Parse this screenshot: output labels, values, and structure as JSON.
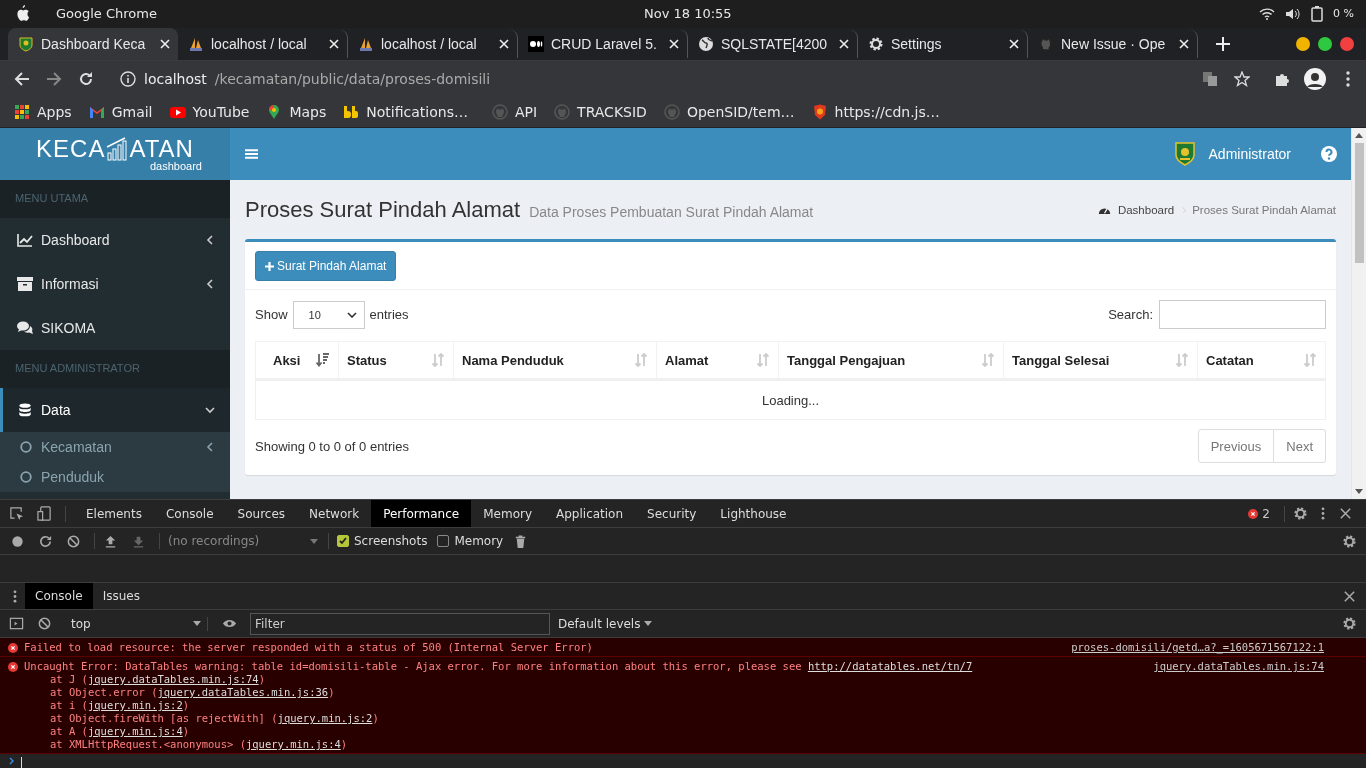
{
  "os_bar": {
    "app_name": "Google Chrome",
    "datetime": "Nov 18  10:55",
    "battery": "0 %"
  },
  "tabs": [
    {
      "title": "Dashboard Keca",
      "kind": "crest",
      "selected": true
    },
    {
      "title": "localhost / local",
      "kind": "sail",
      "selected": false
    },
    {
      "title": "localhost / local",
      "kind": "sail",
      "selected": false
    },
    {
      "title": "CRUD Laravel 5.",
      "kind": "dots",
      "selected": false
    },
    {
      "title": "SQLSTATE[4200",
      "kind": "globe",
      "selected": false
    },
    {
      "title": "Settings",
      "kind": "gear",
      "selected": false
    },
    {
      "title": "New Issue · Ope",
      "kind": "cat",
      "selected": false
    }
  ],
  "address": {
    "host": "localhost",
    "path": "/kecamatan/public/data/proses-domisili"
  },
  "bookmarks": [
    {
      "label": "Apps",
      "kind": "grid"
    },
    {
      "label": "Gmail",
      "kind": "mail"
    },
    {
      "label": "YouTube",
      "kind": "play"
    },
    {
      "label": "Maps",
      "kind": "pin"
    },
    {
      "label": "Notifications…",
      "kind": "yellow"
    },
    {
      "label": "API",
      "kind": "cat"
    },
    {
      "label": "TRACKSID",
      "kind": "cat"
    },
    {
      "label": "OpenSID/tem…",
      "kind": "cat"
    },
    {
      "label": "https://cdn.js…",
      "kind": "shield"
    }
  ],
  "logo": {
    "left": "KECA",
    "right": "ATAN",
    "sub": "dashboard"
  },
  "header": {
    "user": "Administrator"
  },
  "sidebar": [
    {
      "header": "MENU UTAMA",
      "items": [
        {
          "label": "Dashboard",
          "kind": "chart",
          "expanded": false,
          "selected": false
        },
        {
          "label": "Informasi",
          "kind": "archive",
          "expanded": false,
          "selected": false
        },
        {
          "label": "SIKOMA",
          "kind": "comments",
          "selected": false
        }
      ]
    },
    {
      "header": "MENU ADMINISTRATOR",
      "items": [
        {
          "label": "Data",
          "kind": "database",
          "expanded": true,
          "selected": true,
          "children": [
            {
              "label": "Kecamatan",
              "expanded": false
            },
            {
              "label": "Penduduk"
            }
          ]
        }
      ]
    }
  ],
  "page": {
    "title": "Proses Surat Pindah Alamat",
    "subtitle": "Data Proses Pembuatan Surat Pindah Alamat",
    "breadcrumb": [
      "Dashboard",
      "Proses Surat Pindah Alamat"
    ],
    "add_button": "Surat Pindah Alamat",
    "show_label": "Show",
    "length": "10",
    "entries_label": "entries",
    "search_label": "Search:",
    "columns": [
      {
        "label": "Aksi",
        "sorted": true
      },
      {
        "label": "Status",
        "sorted": false
      },
      {
        "label": "Nama Penduduk",
        "sorted": false
      },
      {
        "label": "Alamat",
        "sorted": false
      },
      {
        "label": "Tanggal Pengajuan",
        "sorted": false
      },
      {
        "label": "Tanggal Selesai",
        "sorted": false
      },
      {
        "label": "Catatan",
        "sorted": false
      }
    ],
    "loading": "Loading...",
    "info": "Showing 0 to 0 of 0 entries",
    "pagination": [
      "Previous",
      "Next"
    ]
  },
  "devtools": {
    "tabs": [
      {
        "label": "Elements",
        "selected": false
      },
      {
        "label": "Console",
        "selected": false
      },
      {
        "label": "Sources",
        "selected": false
      },
      {
        "label": "Network",
        "selected": false
      },
      {
        "label": "Performance",
        "selected": true
      },
      {
        "label": "Memory",
        "selected": false
      },
      {
        "label": "Application",
        "selected": false
      },
      {
        "label": "Security",
        "selected": false
      },
      {
        "label": "Lighthouse",
        "selected": false
      }
    ],
    "error_count": "2",
    "recordings": "(no recordings)",
    "checkboxes": [
      {
        "label": "Screenshots",
        "checked": true
      },
      {
        "label": "Memory",
        "checked": false
      }
    ],
    "drawer_tabs": [
      {
        "label": "Console",
        "selected": true
      },
      {
        "label": "Issues",
        "selected": false
      }
    ],
    "context": "top",
    "filter_placeholder": "Filter",
    "levels": "Default levels",
    "messages": [
      {
        "text": "Failed to load resource: the server responded with a status of 500 (Internal Server Error)",
        "source": "proses-domisili/getd…a?_=1605671567122:1"
      },
      {
        "text": "Uncaught Error: DataTables warning: table id=domisili-table - Ajax error. For more information about this error, please see ",
        "link": "http://datatables.net/tn/7",
        "source": "jquery.dataTables.min.js:74",
        "stack": [
          {
            "before": "at J (",
            "file": "jquery.dataTables.min.js:74",
            "after": ")"
          },
          {
            "before": "at Object.error (",
            "file": "jquery.dataTables.min.js:36",
            "after": ")"
          },
          {
            "before": "at i (",
            "file": "jquery.min.js:2",
            "after": ")"
          },
          {
            "before": "at Object.fireWith [as rejectWith] (",
            "file": "jquery.min.js:2",
            "after": ")"
          },
          {
            "before": "at A (",
            "file": "jquery.min.js:4",
            "after": ")"
          },
          {
            "before": "at XMLHttpRequest.<anonymous> (",
            "file": "jquery.min.js:4",
            "after": ")"
          }
        ]
      }
    ]
  }
}
